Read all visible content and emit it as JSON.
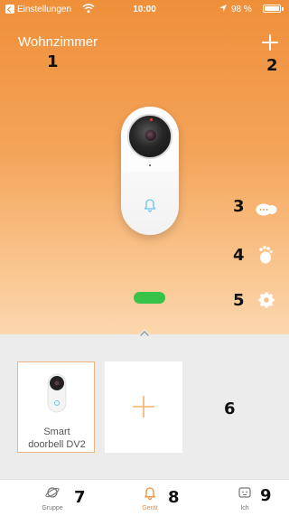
{
  "status_bar": {
    "carrier": "Einstellungen",
    "time": "10:00",
    "battery": "98 %"
  },
  "header": {
    "room_title": "Wohnzimmer",
    "add_icon": "plus-icon"
  },
  "device": {
    "image": "doorbell-device",
    "bell_icon": "bell-icon",
    "status_toggle_color": "#37c24a"
  },
  "side_actions": [
    {
      "icon": "chat-bubbles-icon"
    },
    {
      "icon": "footprints-icon"
    },
    {
      "icon": "gear-icon"
    }
  ],
  "device_list": {
    "items": [
      {
        "label_line1": "Smart",
        "label_line2": "doorbell DV2"
      }
    ],
    "add_icon": "plus-icon"
  },
  "tabs": [
    {
      "label": "Gruppe",
      "icon": "planet-icon",
      "active": false
    },
    {
      "label": "Gerät",
      "icon": "device-bell-icon",
      "active": true
    },
    {
      "label": "Ich",
      "icon": "robot-face-icon",
      "active": false
    }
  ],
  "annotations": [
    "1",
    "2",
    "3",
    "4",
    "5",
    "6",
    "7",
    "8",
    "9"
  ],
  "colors": {
    "accent": "#f08a33",
    "gradient_top": "#ef8f3a",
    "gradient_bottom": "#fbd7ae",
    "panel_bg": "#ececec"
  }
}
